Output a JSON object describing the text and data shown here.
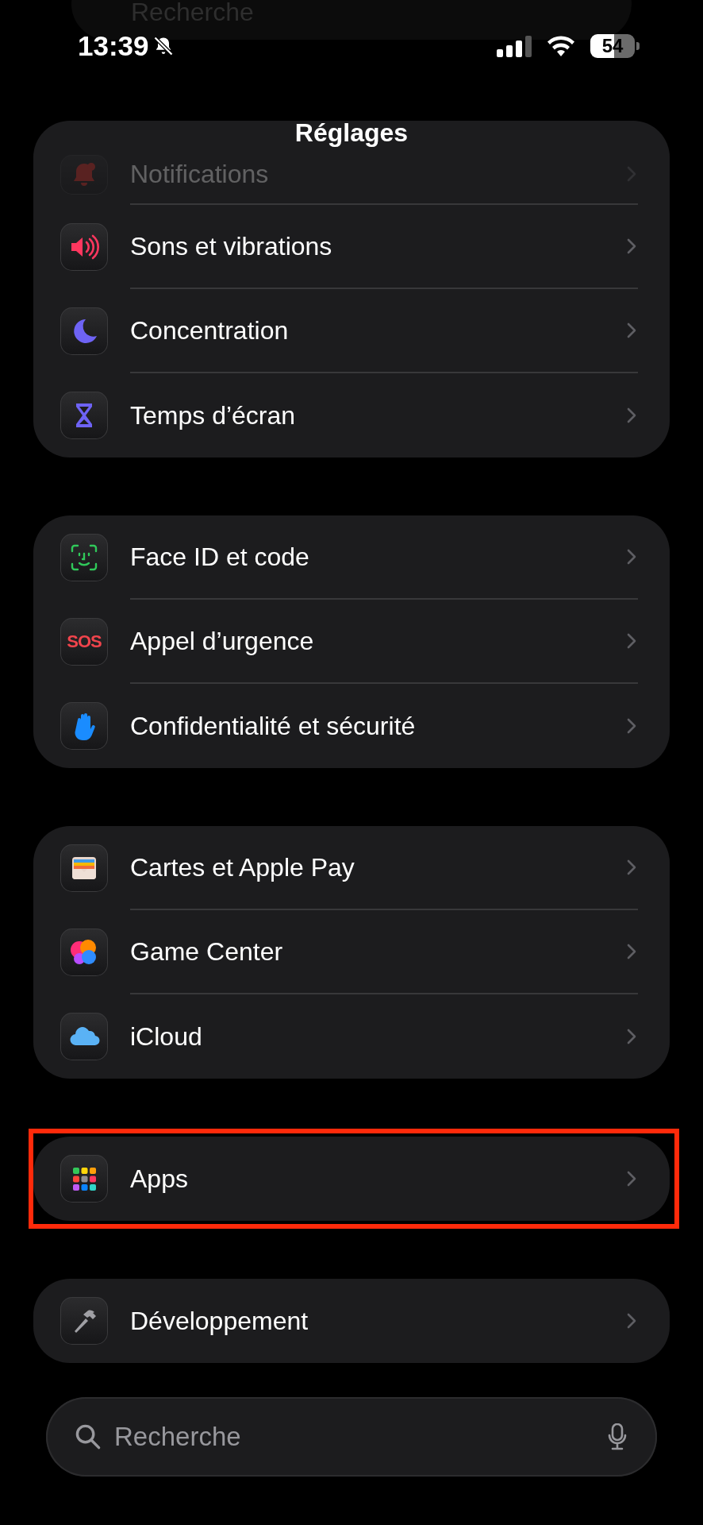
{
  "background_search": {
    "placeholder": "Recherche"
  },
  "status_bar": {
    "time": "13:39",
    "silent": true,
    "battery": "54"
  },
  "title": "Réglages",
  "groups": [
    {
      "items": [
        {
          "label": "Notifications",
          "dimmed": true,
          "highlighted": false
        },
        {
          "label": "Sons et vibrations",
          "dimmed": false,
          "highlighted": false
        },
        {
          "label": "Concentration",
          "dimmed": false,
          "highlighted": false
        },
        {
          "label": "Temps d’écran",
          "dimmed": false,
          "highlighted": false
        }
      ]
    },
    {
      "items": [
        {
          "label": "Face ID et code",
          "dimmed": false,
          "highlighted": false
        },
        {
          "label": "Appel d’urgence",
          "icon_text": "SOS",
          "dimmed": false,
          "highlighted": false
        },
        {
          "label": "Confidentialité et sécurité",
          "dimmed": false,
          "highlighted": false
        }
      ]
    },
    {
      "items": [
        {
          "label": "Cartes et Apple Pay",
          "dimmed": false,
          "highlighted": false
        },
        {
          "label": "Game Center",
          "dimmed": false,
          "highlighted": false
        },
        {
          "label": "iCloud",
          "dimmed": false,
          "highlighted": false
        }
      ]
    },
    {
      "items": [
        {
          "label": "Apps",
          "dimmed": false,
          "highlighted": true
        }
      ]
    },
    {
      "items": [
        {
          "label": "Développement",
          "dimmed": false,
          "highlighted": false
        }
      ]
    }
  ],
  "search": {
    "placeholder": "Recherche"
  }
}
